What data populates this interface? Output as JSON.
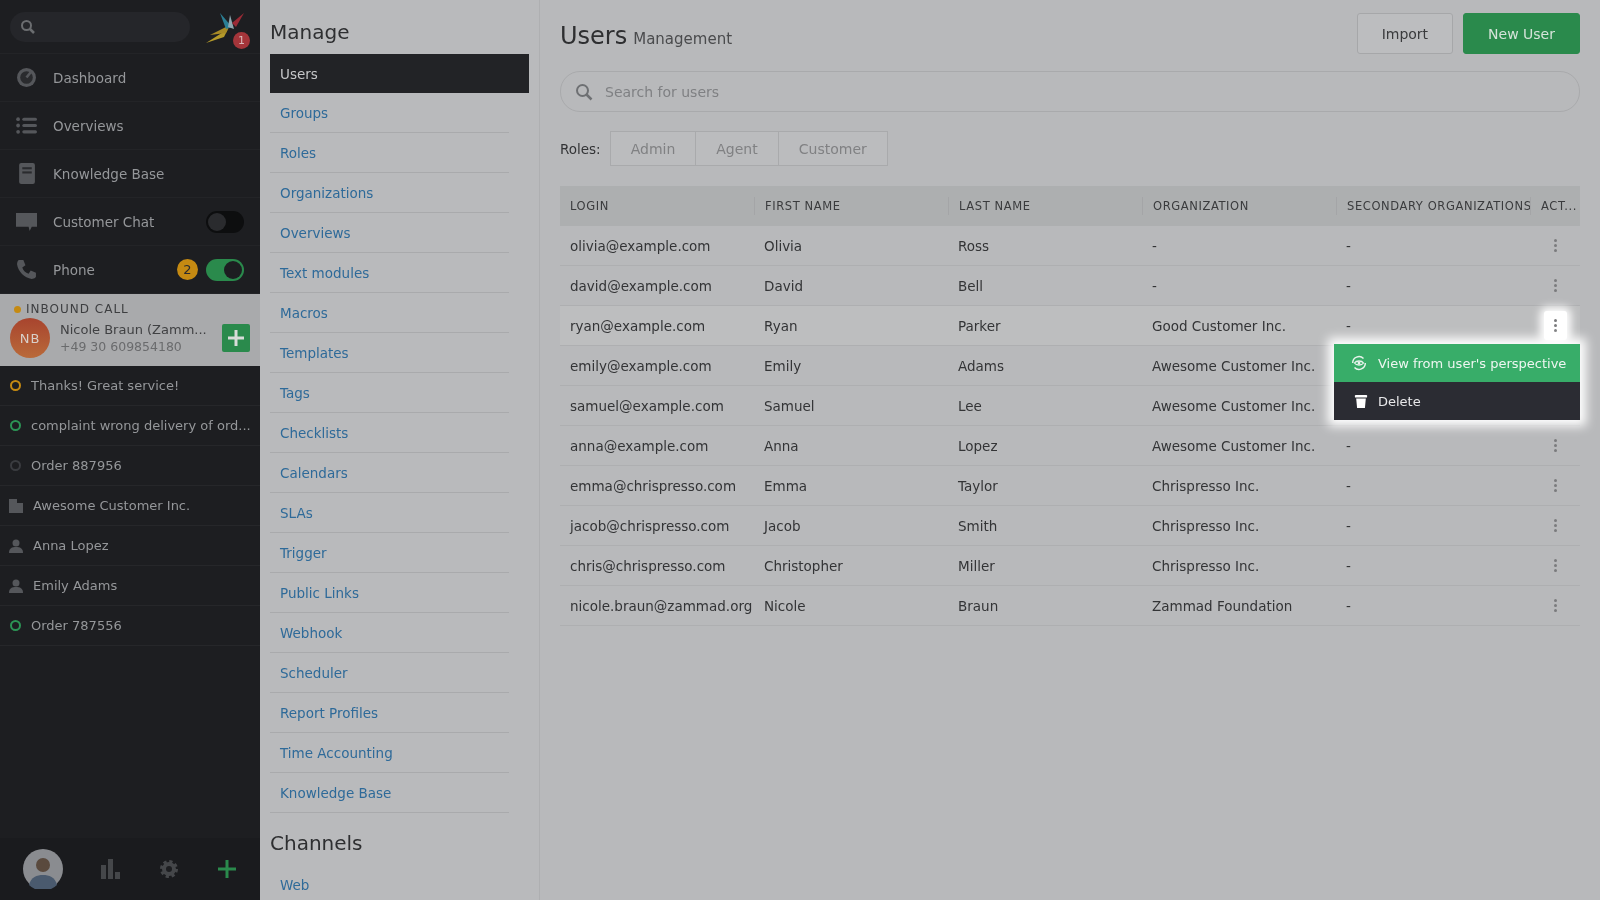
{
  "sidebar": {
    "logo_badge": "1",
    "nav": [
      {
        "label": "Dashboard",
        "kind": "dashboard"
      },
      {
        "label": "Overviews",
        "kind": "list"
      },
      {
        "label": "Knowledge Base",
        "kind": "book"
      },
      {
        "label": "Customer Chat",
        "kind": "chat",
        "on": false
      },
      {
        "label": "Phone",
        "kind": "phone",
        "on": true,
        "count": "2"
      }
    ],
    "call": {
      "label": "INBOUND CALL",
      "initials": "NB",
      "name": "Nicole Braun (Zamm...",
      "number": "+49 30 609854180"
    },
    "tasks": [
      {
        "label": "Thanks! Great service!",
        "kind": "ticket",
        "color": "#c58a12"
      },
      {
        "label": "complaint wrong delivery of ord...",
        "kind": "ticket",
        "color": "#2c9455"
      },
      {
        "label": "Order 887956",
        "kind": "ticket",
        "color": "#3a3c40"
      },
      {
        "label": "Awesome Customer Inc.",
        "kind": "organization"
      },
      {
        "label": "Anna Lopez",
        "kind": "user"
      },
      {
        "label": "Emily Adams",
        "kind": "user"
      },
      {
        "label": "Order 787556",
        "kind": "ticket",
        "color": "#2c9455"
      }
    ]
  },
  "manage": {
    "title": "Manage",
    "items": [
      {
        "label": "Users",
        "selected": true
      },
      {
        "label": "Groups",
        "selected": false
      },
      {
        "label": "Roles",
        "selected": false
      },
      {
        "label": "Organizations",
        "selected": false
      },
      {
        "label": "Overviews",
        "selected": false
      },
      {
        "label": "Text modules",
        "selected": false
      },
      {
        "label": "Macros",
        "selected": false
      },
      {
        "label": "Templates",
        "selected": false
      },
      {
        "label": "Tags",
        "selected": false
      },
      {
        "label": "Checklists",
        "selected": false
      },
      {
        "label": "Calendars",
        "selected": false
      },
      {
        "label": "SLAs",
        "selected": false
      },
      {
        "label": "Trigger",
        "selected": false
      },
      {
        "label": "Public Links",
        "selected": false
      },
      {
        "label": "Webhook",
        "selected": false
      },
      {
        "label": "Scheduler",
        "selected": false
      },
      {
        "label": "Report Profiles",
        "selected": false
      },
      {
        "label": "Time Accounting",
        "selected": false
      },
      {
        "label": "Knowledge Base",
        "selected": false
      }
    ],
    "channels_title": "Channels",
    "channels": [
      {
        "label": "Web",
        "selected": false
      }
    ]
  },
  "main": {
    "title": "Users",
    "subtitle": "Management",
    "buttons": [
      "Import",
      "New User"
    ],
    "search": {
      "placeholder": "Search for users"
    },
    "roles_label": "Roles:",
    "roles": [
      {
        "label": "Admin",
        "selected": false
      },
      {
        "label": "Agent",
        "selected": false
      },
      {
        "label": "Customer",
        "selected": false
      }
    ],
    "table": {
      "columns": [
        "LOGIN",
        "FIRST NAME",
        "LAST NAME",
        "ORGANIZATION",
        "SECONDARY ORGANIZATIONS",
        "ACT..."
      ],
      "rows": [
        {
          "cells": [
            "olivia@example.com",
            "Olivia",
            "Ross",
            "-",
            "-"
          ],
          "menu_open": false
        },
        {
          "cells": [
            "david@example.com",
            "David",
            "Bell",
            "-",
            "-"
          ],
          "menu_open": false
        },
        {
          "cells": [
            "ryan@example.com",
            "Ryan",
            "Parker",
            "Good Customer Inc.",
            "-"
          ],
          "menu_open": true
        },
        {
          "cells": [
            "emily@example.com",
            "Emily",
            "Adams",
            "Awesome Customer Inc."
          ],
          "menu_open": false
        },
        {
          "cells": [
            "samuel@example.com",
            "Samuel",
            "Lee",
            "Awesome Customer Inc."
          ],
          "menu_open": false
        },
        {
          "cells": [
            "anna@example.com",
            "Anna",
            "Lopez",
            "Awesome Customer Inc.",
            "-"
          ],
          "menu_open": false
        },
        {
          "cells": [
            "emma@chrispresso.com",
            "Emma",
            "Taylor",
            "Chrispresso Inc.",
            "-"
          ],
          "menu_open": false
        },
        {
          "cells": [
            "jacob@chrispresso.com",
            "Jacob",
            "Smith",
            "Chrispresso Inc.",
            "-"
          ],
          "menu_open": false
        },
        {
          "cells": [
            "chris@chrispresso.com",
            "Christopher",
            "Miller",
            "Chrispresso Inc.",
            "-"
          ],
          "menu_open": false
        },
        {
          "cells": [
            "nicole.braun@zammad.org",
            "Nicole",
            "Braun",
            "Zammad Foundation",
            "-"
          ],
          "menu_open": false
        }
      ]
    },
    "action_menu": [
      {
        "label": "View from user's perspective",
        "kind": "view"
      },
      {
        "label": "Delete",
        "kind": "delete"
      }
    ]
  }
}
